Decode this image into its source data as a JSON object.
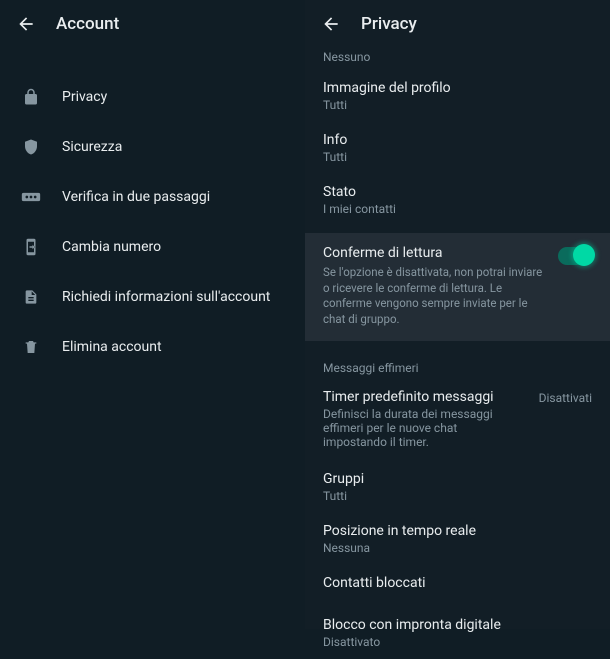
{
  "left": {
    "title": "Account",
    "items": [
      {
        "label": "Privacy"
      },
      {
        "label": "Sicurezza"
      },
      {
        "label": "Verifica in due passaggi"
      },
      {
        "label": "Cambia numero"
      },
      {
        "label": "Richiedi informazioni sull'account"
      },
      {
        "label": "Elimina account"
      }
    ]
  },
  "right": {
    "title": "Privacy",
    "top_sub": "Nessuno",
    "profile_image": {
      "title": "Immagine del profilo",
      "sub": "Tutti"
    },
    "info": {
      "title": "Info",
      "sub": "Tutti"
    },
    "status": {
      "title": "Stato",
      "sub": "I miei contatti"
    },
    "read_receipts": {
      "title": "Conferme di lettura",
      "sub": "Se l'opzione è disattivata, non potrai inviare o ricevere le conferme di lettura. Le conferme vengono sempre inviate per le chat di gruppo."
    },
    "ephemeral_section": "Messaggi effimeri",
    "timer": {
      "title": "Timer predefinito messaggi",
      "sub": "Definisci la durata dei messaggi effimeri per le nuove chat impostando il timer.",
      "value": "Disattivati"
    },
    "groups": {
      "title": "Gruppi",
      "sub": "Tutti"
    },
    "live_location": {
      "title": "Posizione in tempo reale",
      "sub": "Nessuna"
    },
    "blocked": {
      "title": "Contatti bloccati"
    },
    "fingerprint": {
      "title": "Blocco con impronta digitale",
      "sub": "Disattivato"
    }
  }
}
